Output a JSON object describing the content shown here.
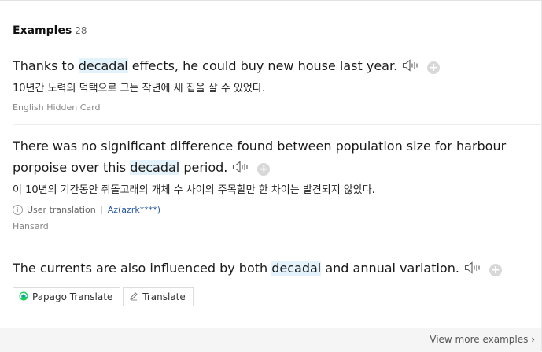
{
  "header": {
    "title": "Examples",
    "count": "28"
  },
  "examples": [
    {
      "en_before": "Thanks to ",
      "en_highlight": "decadal",
      "en_after": " effects, he could buy new house last year.",
      "ko": "10년간 노력의 덕택으로 그는 작년에 새 집을 살 수 있었다.",
      "source": "English Hidden Card"
    },
    {
      "en_before": "There was no significant difference found between population size for harbour porpoise over this ",
      "en_highlight": "decadal",
      "en_after": " period.",
      "ko": "이 10년의 기간동안 쥐돌고래의 개체 수 사이의 주목할만 한 차이는 발견되지 않았다.",
      "user_translation_label": "User translation",
      "user_name": "Az(azrk****)",
      "source": "Hansard"
    },
    {
      "en_before": "The currents are also influenced by both ",
      "en_highlight": "decadal",
      "en_after": " and annual variation.",
      "papago_label": "Papago Translate",
      "translate_label": "Translate"
    }
  ],
  "footer": {
    "view_more": "View more examples"
  },
  "icons": {
    "speaker": "speaker-icon",
    "add": "plus-circle-icon",
    "info": "info-icon",
    "papago": "papago-logo-icon",
    "pencil": "pencil-icon",
    "chevron": "chevron-right-icon"
  },
  "colors": {
    "highlight": "#e4f3fb",
    "link": "#2b5aa3",
    "papago_green": "#19ce60",
    "papago_blue": "#1e88e5"
  }
}
